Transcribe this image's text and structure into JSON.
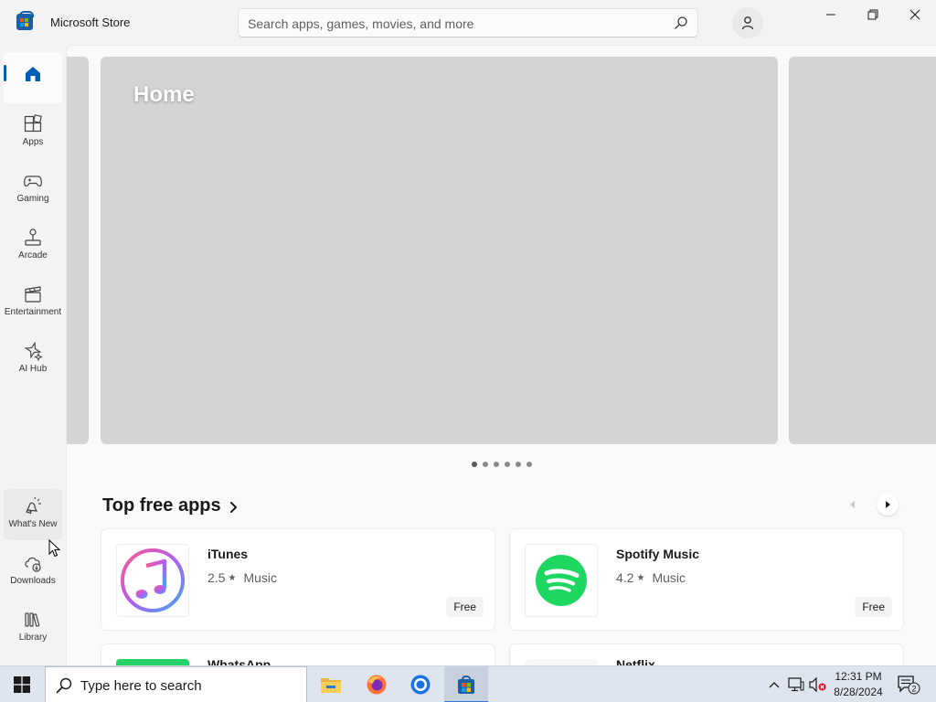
{
  "window": {
    "title": "Microsoft Store",
    "search_placeholder": "Search apps, games, movies, and more"
  },
  "sidebar": {
    "items": [
      {
        "label": "",
        "icon": "home-icon"
      },
      {
        "label": "Apps",
        "icon": "apps-icon"
      },
      {
        "label": "Gaming",
        "icon": "gamepad-icon"
      },
      {
        "label": "Arcade",
        "icon": "joystick-icon"
      },
      {
        "label": "Entertainment",
        "icon": "clapperboard-icon"
      },
      {
        "label": "AI Hub",
        "icon": "ai-sparkle-icon"
      }
    ],
    "bottom_items": [
      {
        "label": "What's New",
        "icon": "megaphone-icon"
      },
      {
        "label": "Downloads",
        "icon": "cloud-download-icon"
      },
      {
        "label": "Library",
        "icon": "library-icon"
      }
    ]
  },
  "hero": {
    "title": "Home",
    "page_count": 6,
    "active_page": 1
  },
  "top_free": {
    "title": "Top free apps",
    "apps": [
      {
        "name": "iTunes",
        "rating": "2.5",
        "category": "Music",
        "price": "Free",
        "icon": "itunes-icon"
      },
      {
        "name": "Spotify Music",
        "rating": "4.2",
        "category": "Music",
        "price": "Free",
        "icon": "spotify-icon"
      }
    ],
    "partial_apps": [
      {
        "name": "WhatsApp",
        "icon": "whatsapp-icon"
      },
      {
        "name": "Netflix",
        "icon": "netflix-icon"
      }
    ]
  },
  "taskbar": {
    "search_placeholder": "Type here to search",
    "apps": [
      "file-explorer-icon",
      "firefox-icon",
      "chrome-icon",
      "microsoft-store-icon"
    ],
    "time": "12:31 PM",
    "date": "8/28/2024",
    "notification_count": "2"
  },
  "colors": {
    "accent": "#005fb8",
    "spotify_green": "#1ed760",
    "hero_placeholder": "#d4d4d4"
  }
}
